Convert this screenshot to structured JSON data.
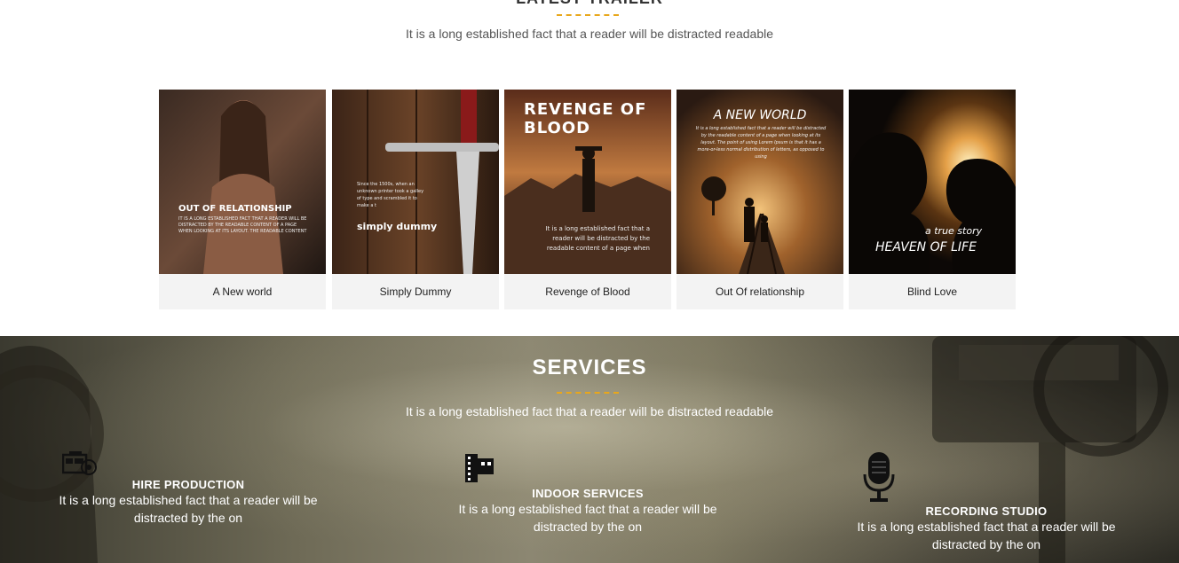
{
  "trailer": {
    "title": "LATEST TRAILER",
    "subtitle": "It is a long established fact that a reader will be distracted readable",
    "cards": [
      {
        "caption": "A New world",
        "poster_title": "OUT OF RELATIONSHIP",
        "poster_text": "It is a long established fact that a reader will be distracted by the readable content of a page when looking at its layout. The readable content"
      },
      {
        "caption": "Simply Dummy",
        "poster_title": "simply dummy",
        "poster_text": "Since the 1500s, when an unknown printer took a galley of type and scrambled it to make a t"
      },
      {
        "caption": "Revenge of Blood",
        "poster_title": "REVENGE OF BLOOD",
        "poster_text": "It is a long established fact that a reader will be distracted by the readable content of a page when"
      },
      {
        "caption": "Out Of relationship",
        "poster_title": "A NEW WORLD",
        "poster_text": "It is a long established fact that a reader will be distracted by the readable content of a page when looking at its layout. The point of using Lorem Ipsum is that it has a more-or-less normal distribution of letters, as opposed to using"
      },
      {
        "caption": "Blind Love",
        "poster_title": "HEAVEN OF LIFE",
        "poster_tagline": "a true story"
      }
    ]
  },
  "services": {
    "title": "SERVICES",
    "subtitle": "It is a long established fact that a reader will be distracted readable",
    "items": [
      {
        "icon": "film-production-icon",
        "title": "HIRE PRODUCTION",
        "text": "It is a long established fact that a reader will be distracted by the on"
      },
      {
        "icon": "film-strip-icon",
        "title": "INDOOR SERVICES",
        "text": "It is a long established fact that a reader will be distracted by the on"
      },
      {
        "icon": "microphone-icon",
        "title": "RECORDING STUDIO",
        "text": "It is a long established fact that a reader will be distracted by the on"
      }
    ]
  },
  "colors": {
    "accent": "#e8a71c",
    "card_background": "#f3f3f3"
  }
}
